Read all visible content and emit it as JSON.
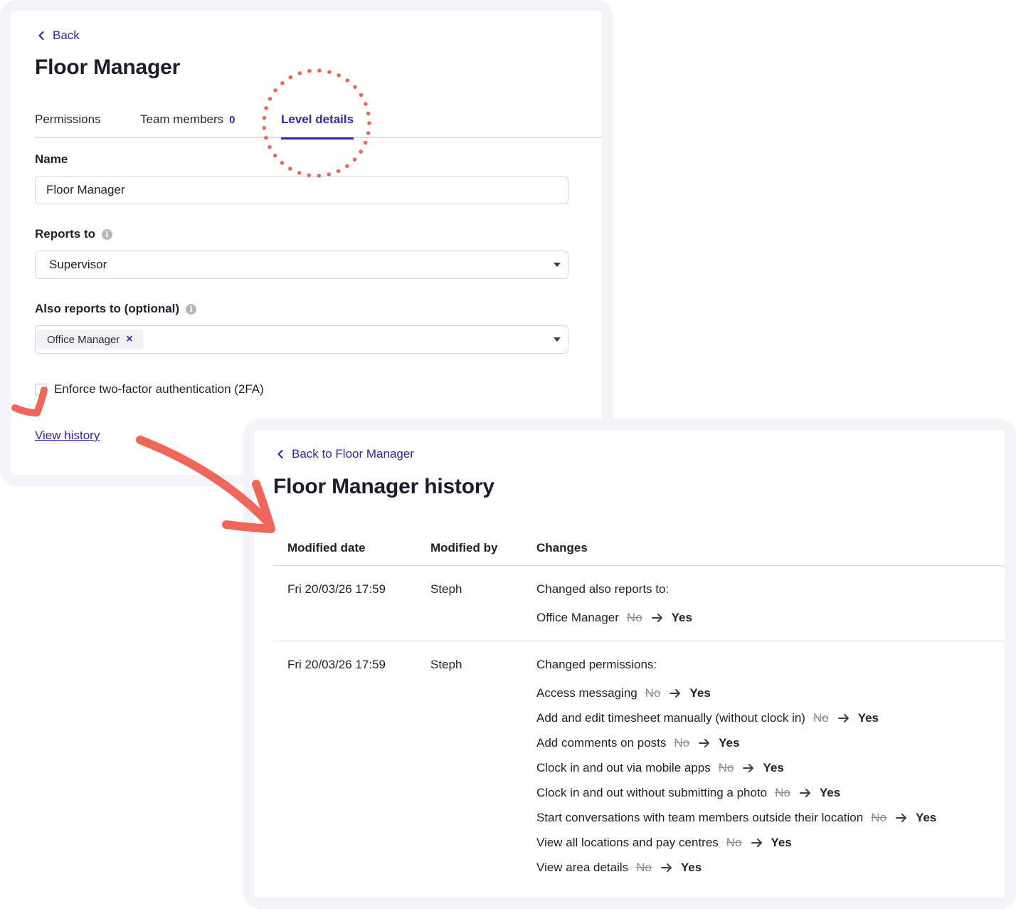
{
  "level_details_screen": {
    "back_label": "Back",
    "title": "Floor Manager",
    "tabs": [
      {
        "label": "Permissions",
        "count": ""
      },
      {
        "label": "Team members",
        "count": "0"
      },
      {
        "label": "Level details",
        "count": ""
      }
    ],
    "active_tab": "Level details",
    "name_label": "Name",
    "name_value": "Floor Manager",
    "reports_to_label": "Reports to",
    "reports_to_value": "Supervisor",
    "also_reports_to_label": "Also reports to (optional)",
    "also_reports_to_tags": [
      "Office Manager"
    ],
    "tag_remove_glyph": "×",
    "enforce_2fa_label": "Enforce two-factor authentication (2FA)",
    "enforce_2fa_checked": false,
    "view_history_label": "View history"
  },
  "history_screen": {
    "back_label": "Back to Floor Manager",
    "title": "Floor Manager history",
    "columns": [
      "Modified date",
      "Modified by",
      "Changes"
    ],
    "rows": [
      {
        "date": "Fri 20/03/26 17:59",
        "by": "Steph",
        "heading": "Changed also reports to:",
        "changes": [
          {
            "item": "Office Manager",
            "from": "No",
            "to": "Yes"
          }
        ]
      },
      {
        "date": "Fri 20/03/26 17:59",
        "by": "Steph",
        "heading": "Changed permissions:",
        "changes": [
          {
            "item": "Access messaging",
            "from": "No",
            "to": "Yes"
          },
          {
            "item": "Add and edit timesheet manually (without clock in)",
            "from": "No",
            "to": "Yes"
          },
          {
            "item": "Add comments on posts",
            "from": "No",
            "to": "Yes"
          },
          {
            "item": "Clock in and out via mobile apps",
            "from": "No",
            "to": "Yes"
          },
          {
            "item": "Clock in and out without submitting a photo",
            "from": "No",
            "to": "Yes"
          },
          {
            "item": "Start conversations with team members outside their location",
            "from": "No",
            "to": "Yes"
          },
          {
            "item": "View all locations and pay centres",
            "from": "No",
            "to": "Yes"
          },
          {
            "item": "View area details",
            "from": "No",
            "to": "Yes"
          }
        ]
      }
    ]
  },
  "icons": {
    "back": "chevron-left-icon",
    "info": "info-icon",
    "dropdown": "caret-down-icon",
    "change_arrow": "arrow-right-icon"
  },
  "colors": {
    "accent": "#3a22b5",
    "annotation": "#f0665a",
    "frame": "#f3f4f7",
    "muted": "#8a8c99",
    "text": "#1f2030"
  }
}
